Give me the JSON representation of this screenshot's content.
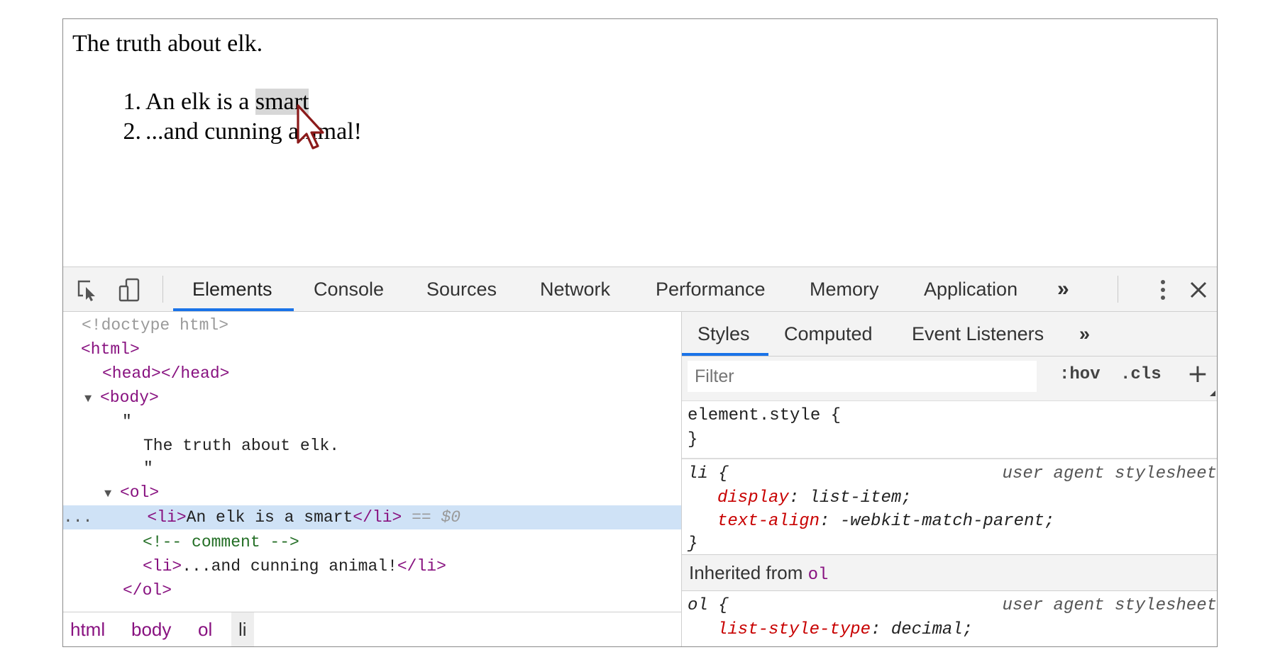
{
  "page": {
    "heading": "The truth about elk.",
    "list_items": [
      {
        "number": "1.",
        "text_before": "An elk is a ",
        "highlighted": "smart",
        "text_after": ""
      },
      {
        "number": "2.",
        "text_before": "...and cunning animal!",
        "highlighted": "",
        "text_after": ""
      }
    ]
  },
  "devtools": {
    "toolbar_icons": [
      "inspect-element-icon",
      "device-toolbar-icon",
      "more-options-icon",
      "close-icon"
    ],
    "tabs": [
      {
        "label": "Elements",
        "active": true
      },
      {
        "label": "Console",
        "active": false
      },
      {
        "label": "Sources",
        "active": false
      },
      {
        "label": "Network",
        "active": false
      },
      {
        "label": "Performance",
        "active": false
      },
      {
        "label": "Memory",
        "active": false
      },
      {
        "label": "Application",
        "active": false
      }
    ],
    "overflow_label": "»",
    "dom": {
      "doctype": "<!doctype html>",
      "html_open": "<html>",
      "head": "<head></head>",
      "body_open": "<body>",
      "quote_open": "\"",
      "text_node": "The truth about elk.",
      "quote_close": "\"",
      "ol_open": "<ol>",
      "li1_open": "<li>",
      "li1_text": "An elk is a smart",
      "li1_close": "</li>",
      "li1_suffix": " == $0",
      "selected_dots": "...",
      "comment": "<!-- comment -->",
      "li2_open": "<li>",
      "li2_text": "...and cunning animal!",
      "li2_close": "</li>",
      "ol_close": "</ol>"
    },
    "breadcrumbs": [
      {
        "label": "html",
        "active": false
      },
      {
        "label": "body",
        "active": false
      },
      {
        "label": "ol",
        "active": false
      },
      {
        "label": "li",
        "active": true
      }
    ],
    "styles_pane": {
      "subtabs": [
        {
          "label": "Styles",
          "active": true
        },
        {
          "label": "Computed",
          "active": false
        },
        {
          "label": "Event Listeners",
          "active": false
        }
      ],
      "overflow_label": "»",
      "filter_placeholder": "Filter",
      "hov_label": ":hov",
      "cls_label": ".cls",
      "add_label": "+",
      "element_style_open": "element.style {",
      "element_style_close": "}",
      "li_rule": {
        "selector": "li {",
        "origin": "user agent stylesheet",
        "declarations": [
          {
            "property": "display",
            "value": "list-item;"
          },
          {
            "property": "text-align",
            "value": "-webkit-match-parent;"
          }
        ],
        "close": "}"
      },
      "inherited_label": "Inherited from",
      "inherited_tag": "ol",
      "ol_rule": {
        "selector": "ol {",
        "origin": "user agent stylesheet",
        "partial_property": "list-style-type",
        "partial_value": "decimal;"
      }
    }
  }
}
